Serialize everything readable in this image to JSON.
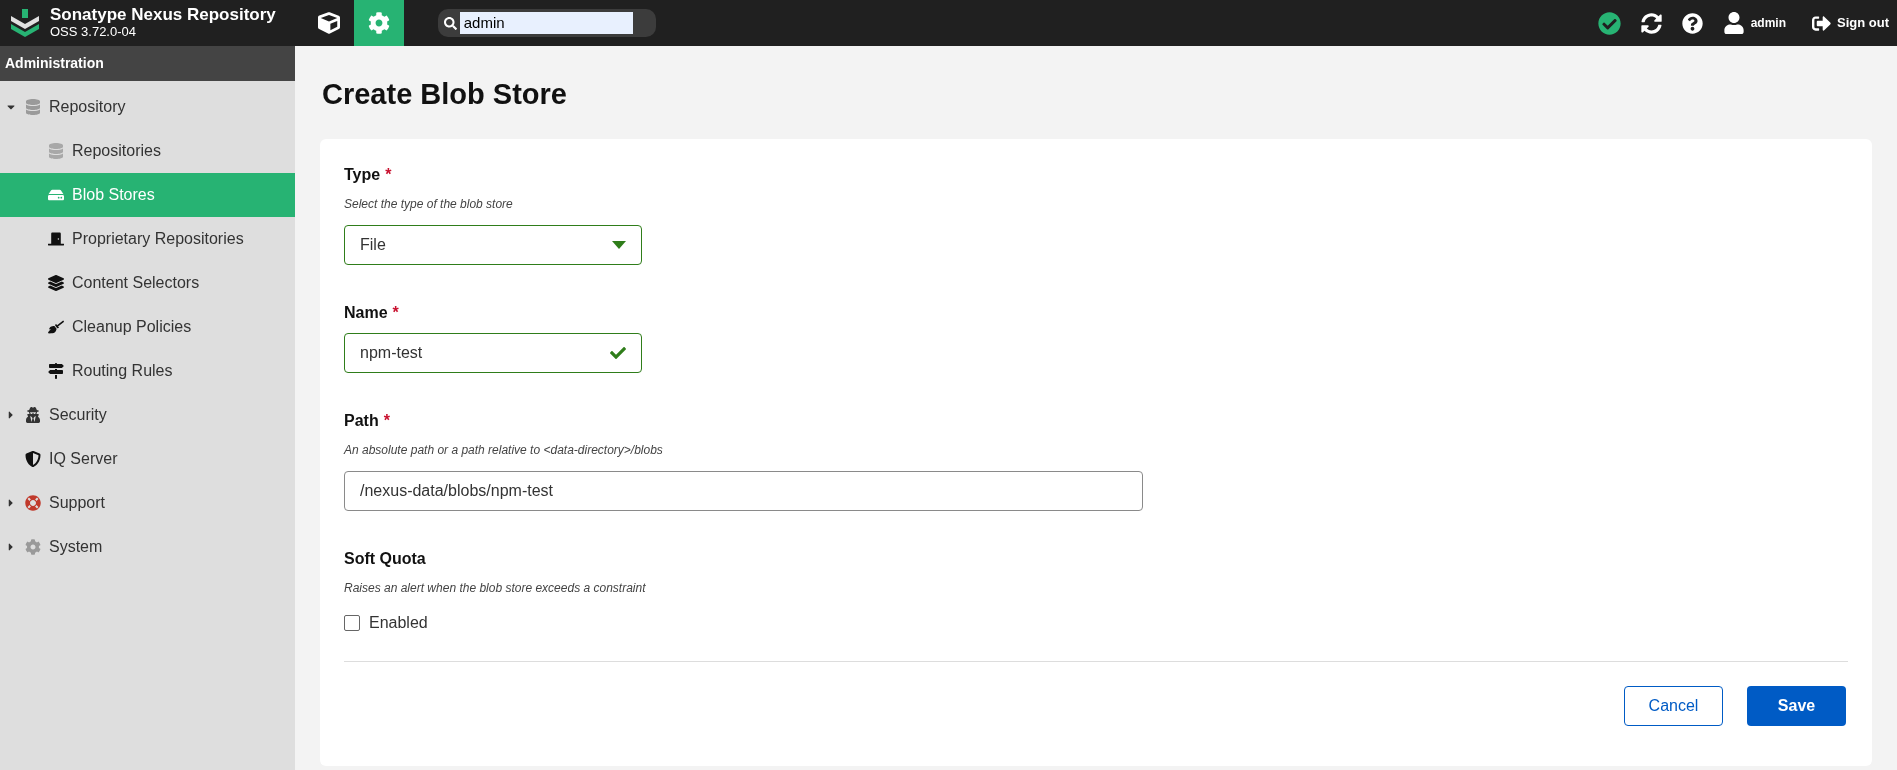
{
  "header": {
    "title": "Sonatype Nexus Repository",
    "version": "OSS 3.72.0-04",
    "nav": [
      {
        "selected": false
      },
      {
        "selected": true
      }
    ],
    "search": {
      "value": "admin"
    },
    "user": "admin",
    "sign_out": "Sign out"
  },
  "sidebar": {
    "title": "Administration",
    "items": [
      {
        "label": "Repository",
        "expanded": true,
        "selected": false,
        "children": [
          {
            "label": "Repositories",
            "selected": false
          },
          {
            "label": "Blob Stores",
            "selected": true
          },
          {
            "label": "Proprietary Repositories",
            "selected": false
          },
          {
            "label": "Content Selectors",
            "selected": false
          },
          {
            "label": "Cleanup Policies",
            "selected": false
          },
          {
            "label": "Routing Rules",
            "selected": false
          }
        ]
      },
      {
        "label": "Security",
        "expanded": false,
        "selected": false
      },
      {
        "label": "IQ Server",
        "selected": false
      },
      {
        "label": "Support",
        "expanded": false,
        "selected": false
      },
      {
        "label": "System",
        "expanded": false,
        "selected": false
      }
    ]
  },
  "page": {
    "title": "Create Blob Store",
    "fields": [
      {
        "kind": "select",
        "label": "Type",
        "required_mark": "*",
        "hint": "Select the type of the blob store",
        "value": "File",
        "valid": true
      },
      {
        "kind": "text",
        "label": "Name",
        "required_mark": "*",
        "value": "npm-test",
        "valid": true
      },
      {
        "kind": "long_text",
        "label": "Path",
        "required_mark": "*",
        "hint": "An absolute path or a path relative to <data-directory>/blobs",
        "value": "/nexus-data/blobs/npm-test",
        "valid": false
      },
      {
        "kind": "checkbox",
        "label": "Soft Quota",
        "hint": "Raises an alert when the blob store exceeds a constraint",
        "option": "Enabled",
        "checked": false
      }
    ],
    "buttons": [
      {
        "label": "Cancel",
        "kind": "secondary"
      },
      {
        "label": "Save",
        "kind": "primary"
      }
    ]
  }
}
